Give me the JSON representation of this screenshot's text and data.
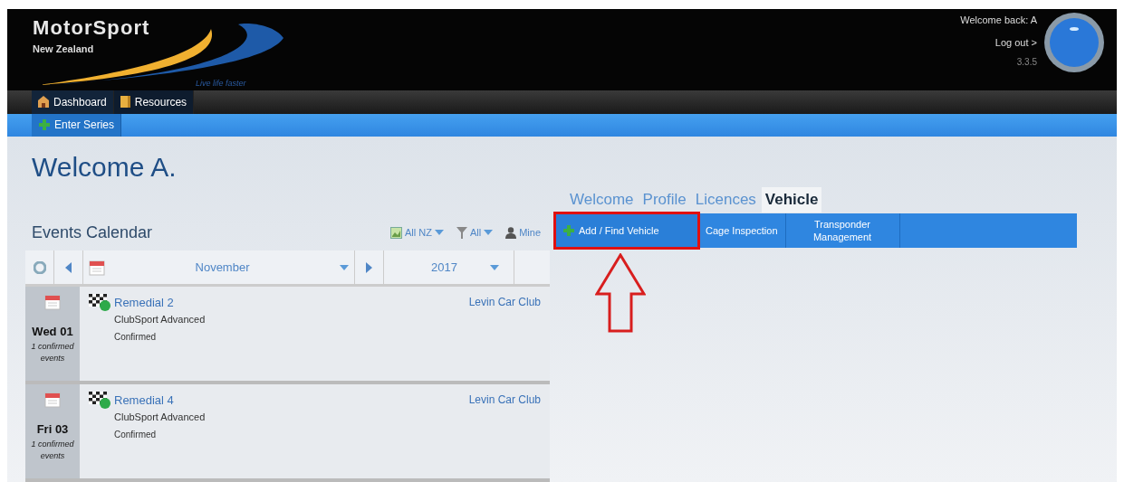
{
  "header": {
    "logo_title": "MotorSport",
    "logo_subtitle": "New Zealand",
    "tagline": "Live life faster",
    "welcome": "Welcome back: A",
    "logout": "Log out >",
    "version": "3.3.5"
  },
  "nav": [
    {
      "label": "Dashboard",
      "selected": true
    },
    {
      "label": "Resources",
      "selected": false
    }
  ],
  "subnav": [
    {
      "label": "Enter Series",
      "selected": true
    }
  ],
  "page_title": "Welcome A.",
  "calendar": {
    "title": "Events Calendar",
    "filters": [
      {
        "label": "All NZ",
        "kind": "region"
      },
      {
        "label": "All",
        "kind": "filter"
      },
      {
        "label": "Mine",
        "kind": "user"
      }
    ],
    "month": "November",
    "year": "2017",
    "days": [
      {
        "day": "Wed 01",
        "count": "1 confirmed events",
        "events": [
          {
            "name": "Remedial 2",
            "category": "ClubSport Advanced",
            "status": "Confirmed",
            "club": "Levin Car Club"
          }
        ]
      },
      {
        "day": "Fri 03",
        "count": "1 confirmed events",
        "events": [
          {
            "name": "Remedial 4",
            "category": "ClubSport Advanced",
            "status": "Confirmed",
            "club": "Levin Car Club"
          }
        ]
      }
    ]
  },
  "tabs": [
    {
      "label": "Welcome",
      "selected": false
    },
    {
      "label": "Profile",
      "selected": false
    },
    {
      "label": "Licences",
      "selected": false
    },
    {
      "label": "Vehicle",
      "selected": true
    }
  ],
  "vehicle_actions": [
    {
      "label": "Add / Find Vehicle",
      "highlighted": true
    },
    {
      "label": "Cage Inspection",
      "highlighted": false
    },
    {
      "label": "Transponder Management",
      "highlighted": false
    }
  ]
}
